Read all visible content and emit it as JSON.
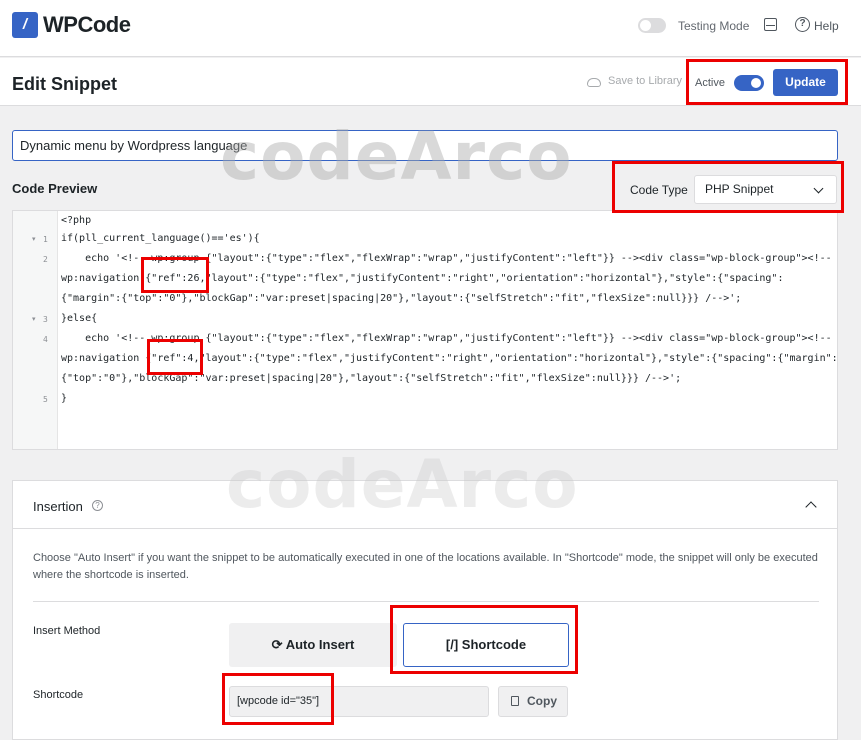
{
  "app": {
    "logo_text": "WPCode",
    "logo_mark": "/"
  },
  "topbar": {
    "testing_mode_label": "Testing Mode",
    "help_label": "Help",
    "help_icon": "?"
  },
  "header": {
    "title": "Edit Snippet",
    "save_to_library": "Save to Library",
    "active_label": "Active",
    "update_label": "Update"
  },
  "snippet": {
    "title_value": "Dynamic menu by Wordpress language"
  },
  "code_preview": {
    "label": "Code Preview",
    "code_type_label": "Code Type",
    "code_type_value": "PHP Snippet",
    "lines": [
      {
        "num": "",
        "text": "<?php"
      },
      {
        "num": "1",
        "text": "if(pll_current_language()=='es'){"
      },
      {
        "num": "2",
        "text": "    echo '<!-- wp:group {\"layout\":{\"type\":\"flex\",\"flexWrap\":\"wrap\",\"justifyContent\":\"left\"}} --><div class=\"wp-block-group\"><!--"
      },
      {
        "num": "",
        "text": "wp:navigation {\"ref\":26,\"layout\":{\"type\":\"flex\",\"justifyContent\":\"right\",\"orientation\":\"horizontal\"},\"style\":{\"spacing\":"
      },
      {
        "num": "",
        "text": "{\"margin\":{\"top\":\"0\"},\"blockGap\":\"var:preset|spacing|20\"},\"layout\":{\"selfStretch\":\"fit\",\"flexSize\":null}}} /-->';"
      },
      {
        "num": "3",
        "text": "}else{"
      },
      {
        "num": "4",
        "text": "    echo '<!-- wp:group {\"layout\":{\"type\":\"flex\",\"flexWrap\":\"wrap\",\"justifyContent\":\"left\"}} --><div class=\"wp-block-group\"><!--"
      },
      {
        "num": "",
        "text": "wp:navigation {\"ref\":4,\"layout\":{\"type\":\"flex\",\"justifyContent\":\"right\",\"orientation\":\"horizontal\"},\"style\":{\"spacing\":{\"margin\":"
      },
      {
        "num": "",
        "text": "{\"top\":\"0\"},\"blockGap\":\"var:preset|spacing|20\"},\"layout\":{\"selfStretch\":\"fit\",\"flexSize\":null}}} /-->';"
      },
      {
        "num": "5",
        "text": "}"
      }
    ]
  },
  "watermark": "codeArco",
  "insertion": {
    "title": "Insertion",
    "info_icon": "?",
    "description": "Choose \"Auto Insert\" if you want the snippet to be automatically executed in one of the locations available. In \"Shortcode\" mode, the snippet will only be executed where the shortcode is inserted.",
    "insert_method_label": "Insert Method",
    "auto_insert_label": "⟳ Auto Insert",
    "shortcode_button_label": "[/] Shortcode",
    "shortcode_label": "Shortcode",
    "shortcode_value": "[wpcode id=\"35\"]",
    "copy_label": "Copy"
  },
  "colors": {
    "accent": "#3664c5",
    "highlight_box": "#ec0000"
  }
}
